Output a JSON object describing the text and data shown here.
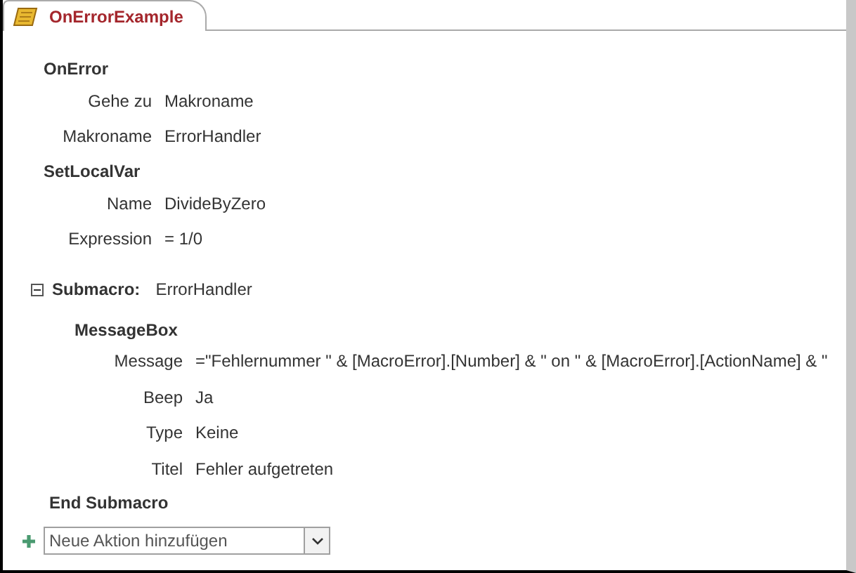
{
  "tab": {
    "title": "OnErrorExample",
    "selected": true
  },
  "actions": [
    {
      "name": "OnError",
      "arguments": [
        {
          "label": "Gehe zu",
          "value": "Makroname"
        },
        {
          "label": "Makroname",
          "value": "ErrorHandler"
        }
      ]
    },
    {
      "name": "SetLocalVar",
      "arguments": [
        {
          "label": "Name",
          "value": "DivideByZero"
        },
        {
          "label": "Expression",
          "value": "= 1/0"
        }
      ]
    }
  ],
  "submacro": {
    "label": "Submacro:",
    "name": "ErrorHandler",
    "expanded": true,
    "actions": [
      {
        "name": "MessageBox",
        "arguments": [
          {
            "label": "Message",
            "value": "=\"Fehlernummer \" & [MacroError].[Number] & \" on \" & [MacroError].[ActionName] & \""
          },
          {
            "label": "Beep",
            "value": "Ja"
          },
          {
            "label": "Type",
            "value": "Keine"
          },
          {
            "label": "Titel",
            "value": "Fehler aufgetreten"
          }
        ]
      }
    ],
    "end_label": "End Submacro"
  },
  "add_action": {
    "placeholder": "Neue Aktion hinzufügen"
  }
}
